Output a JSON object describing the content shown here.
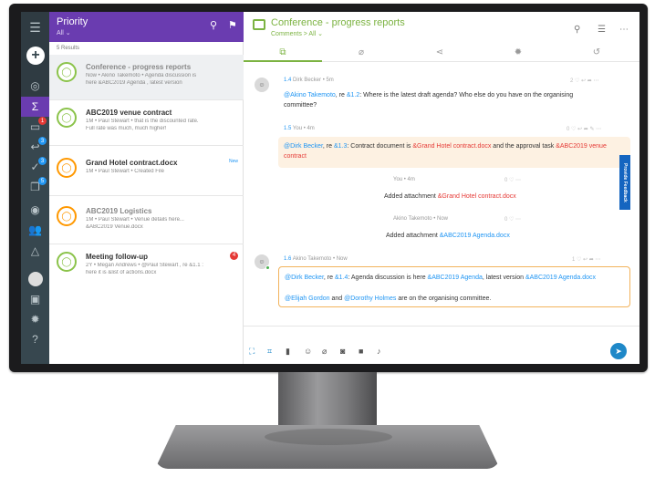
{
  "rail": {
    "icons": [
      "menu-icon",
      "add-icon",
      "at-icon",
      "sigma-icon",
      "chat-icon",
      "reply-icon",
      "check-icon",
      "copy-icon",
      "target-icon",
      "people-icon",
      "bell-icon",
      "user-icon",
      "edit-icon",
      "gear-icon",
      "help-icon"
    ],
    "badges": {
      "chat": "1",
      "reply": "3",
      "check": "3",
      "copy": "5"
    }
  },
  "list": {
    "title": "Priority",
    "filter": "All",
    "results": "5 Results",
    "items": [
      {
        "title": "Conference - progress reports",
        "line1": "Now • Akino Takemoto • Agenda discussion is",
        "line2": "here &ABC2019 Agenda , latest version",
        "tag": ""
      },
      {
        "title": "ABC2019 venue contract",
        "line1": "1M • Paul Stewart • that is the discounted rate.",
        "line2": "Full rate was much, much higher!",
        "tag": ""
      },
      {
        "title": "Grand Hotel contract.docx",
        "line1": "1M • Paul Stewart • Created File",
        "line2": "",
        "tag": "New"
      },
      {
        "title": "ABC2019 Logistics",
        "line1": "1M • Paul Stewart • Venue details here...",
        "line2": "&ABC2019 Venue.docx",
        "tag": ""
      },
      {
        "title": "Meeting follow-up",
        "line1": "2Y • Megan Andrews • @Paul Stewart , re &1.1 :",
        "line2": "here it is &list of actions.docx",
        "tag": "4"
      }
    ]
  },
  "chat": {
    "title": "Conference - progress reports",
    "subtitle": "Comments > All",
    "messages": [
      {
        "num": "1.4",
        "author": "Dirk Becker",
        "time": "5m",
        "count": "2",
        "mention": "@Akino Takemoto",
        "text1": ", re ",
        "ref": "&1.2",
        "text2": ": Where is the latest draft agenda? Who else do you have on the organising",
        "text3": "committee?"
      },
      {
        "num": "1.5",
        "author": "You",
        "time": "4m",
        "count": "0",
        "mention": "@Dirk Becker",
        "text1": ", re ",
        "ref": "&1.3",
        "text2": ": Contract document is ",
        "doc1": "&Grand Hotel contract.docx",
        "text3": " and the approval task ",
        "doc2": "&ABC2019 venue",
        "doc3": "contract"
      },
      {
        "num": "1.6",
        "author": "Akino Takemoto",
        "time": "Now",
        "count": "1",
        "mention": "@Dirk Becker",
        "text1": ", re ",
        "ref": "&1.4",
        "text2": ": Agenda discussion is here ",
        "doc1": "&ABC2019 Agenda",
        "text3": ", latest version ",
        "doc2": "&ABC2019 Agenda.docx",
        "line2_m1": "@Elijah Gordon",
        "line2_and": " and ",
        "line2_m2": "@Dorothy Holmes",
        "line2_end": " are on the organising committee."
      }
    ],
    "sys1": {
      "meta": "You • 4m",
      "count": "0",
      "prefix": "Added attachment ",
      "doc": "&Grand Hotel contract.docx"
    },
    "sys2": {
      "meta": "Akino Takemoto • Now",
      "count": "0",
      "prefix": "Added attachment ",
      "doc": "&ABC2019 Agenda.docx"
    }
  },
  "feedback": "Provide Feedback",
  "colors": {
    "purple": "#6a3cb0",
    "green": "#7cb342",
    "blue": "#1e88c8",
    "rail": "#37474f"
  }
}
